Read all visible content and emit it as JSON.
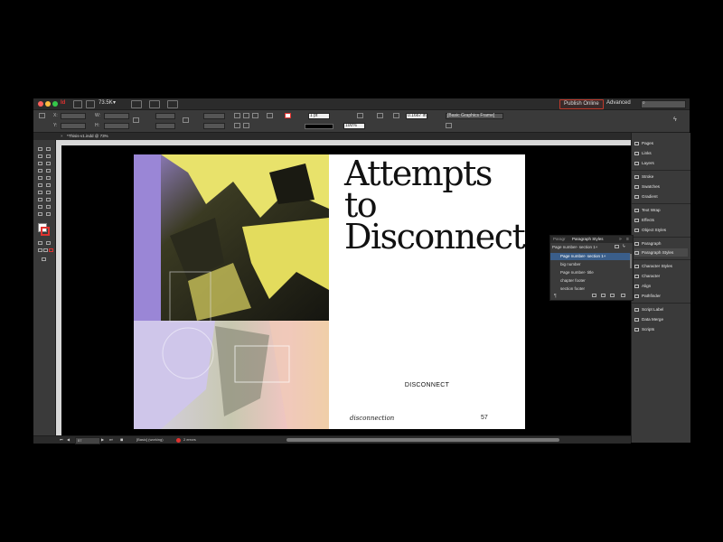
{
  "window": {
    "zoom": "73.5K",
    "publish_label": "Publish Online",
    "workspace": "Advanced",
    "search_placeholder": ""
  },
  "control_bar": {
    "stroke_weight": "1 pt",
    "opacity": "100%",
    "frame_width": "0.1667 in",
    "object_style": "[Basic Graphics Frame]"
  },
  "document": {
    "tab_title": "*Thisis-v1.indd @ 73%"
  },
  "status": {
    "page_field": "57",
    "preflight_profile": "[Basic] (working)",
    "errors": "2 errors"
  },
  "spread": {
    "heading_line1": "Attempts to",
    "heading_line2": "Disconnect",
    "center_word": "DISCONNECT",
    "footer_left": "disconnection",
    "footer_page": "57"
  },
  "paragraph_panel": {
    "tab_other": "Paragr",
    "tab_active": "Paragraph Styles",
    "current_style": "Page number- section 1+",
    "styles": [
      "Page number- section 1+",
      "big number",
      "Page number- title",
      "chapter footer",
      "section footer"
    ]
  },
  "dock": {
    "items": [
      "Pages",
      "Links",
      "Layers",
      "Stroke",
      "Swatches",
      "Gradient",
      "Text Wrap",
      "Effects",
      "Object Styles",
      "Paragraph",
      "Paragraph Styles",
      "Character Styles",
      "Character",
      "Align",
      "Pathfinder",
      "Script Label",
      "Data Merge",
      "Scripts"
    ]
  },
  "colors": {
    "accent_red": "#e0322f",
    "highlight_blue": "#3a5e8a"
  }
}
